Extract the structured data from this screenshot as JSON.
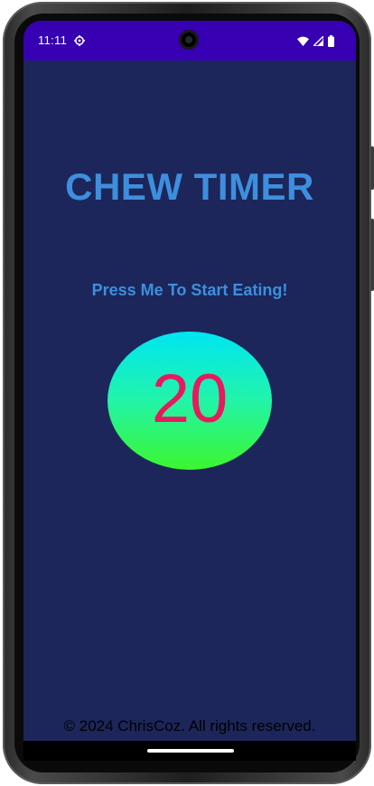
{
  "status_bar": {
    "time": "11:11",
    "icons": [
      "settings-gear-icon",
      "wifi-icon",
      "signal-icon",
      "battery-icon"
    ],
    "background": "#3700b3"
  },
  "app": {
    "title": "CHEW TIMER",
    "start_prompt": "Press Me To Start Eating!",
    "chew_count": "20",
    "footer": "© 2024 ChrisCoz. All rights reserved."
  },
  "colors": {
    "screen_background": "#1c265a",
    "title": "#3d8fde",
    "count": "#e8195d",
    "button_gradient_top": "#00e5f3",
    "button_gradient_bottom": "#3cf62e"
  }
}
